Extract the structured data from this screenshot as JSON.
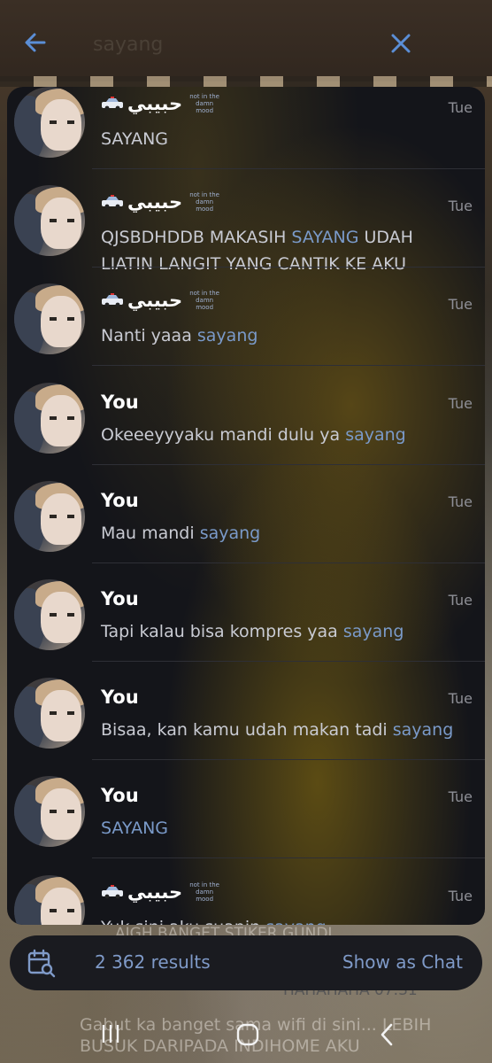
{
  "header": {
    "title": "sayang",
    "back_icon": "arrow-left-icon",
    "close_icon": "close-icon"
  },
  "results": [
    {
      "sender": "حبيبي",
      "sender_type": "contact",
      "status": "not in the damn mood",
      "time": "Tue",
      "parts": [
        {
          "t": "SAYANG",
          "h": false
        }
      ]
    },
    {
      "sender": "حبيبي",
      "sender_type": "contact",
      "status": "not in the damn mood",
      "time": "Tue",
      "parts": [
        {
          "t": "QJSBDHDDB MAKASIH ",
          "h": false
        },
        {
          "t": "SAYANG",
          "h": true
        },
        {
          "t": " UDAH LIATIN LANGIT YANG CANTIK KE AKU",
          "h": false
        }
      ]
    },
    {
      "sender": "حبيبي",
      "sender_type": "contact",
      "status": "not in the damn mood",
      "time": "Tue",
      "parts": [
        {
          "t": "Nanti yaaa ",
          "h": false
        },
        {
          "t": "sayang",
          "h": true
        }
      ]
    },
    {
      "sender": "You",
      "sender_type": "self",
      "status": "",
      "time": "Tue",
      "parts": [
        {
          "t": "Okeeeyyyaku mandi dulu ya ",
          "h": false
        },
        {
          "t": "sayang",
          "h": true
        }
      ]
    },
    {
      "sender": "You",
      "sender_type": "self",
      "status": "",
      "time": "Tue",
      "parts": [
        {
          "t": "Mau mandi ",
          "h": false
        },
        {
          "t": "sayang",
          "h": true
        }
      ]
    },
    {
      "sender": "You",
      "sender_type": "self",
      "status": "",
      "time": "Tue",
      "parts": [
        {
          "t": "Tapi kalau bisa kompres yaa ",
          "h": false
        },
        {
          "t": "sayang",
          "h": true
        }
      ]
    },
    {
      "sender": "You",
      "sender_type": "self",
      "status": "",
      "time": "Tue",
      "parts": [
        {
          "t": "Bisaa, kan kamu udah makan tadi ",
          "h": false
        },
        {
          "t": "sayang",
          "h": true
        }
      ]
    },
    {
      "sender": "You",
      "sender_type": "self",
      "status": "",
      "time": "Tue",
      "parts": [
        {
          "t": "SAYANG",
          "h": true
        }
      ]
    },
    {
      "sender": "حبيبي",
      "sender_type": "contact",
      "status": "not in the damn mood",
      "time": "Tue",
      "parts": [
        {
          "t": "Yuk sini aku suapin ",
          "h": false
        },
        {
          "t": "sayang",
          "h": true
        }
      ]
    }
  ],
  "searchbar": {
    "calendar_icon": "calendar-search-icon",
    "count": "2 362 results",
    "show_as_chat": "Show as Chat"
  },
  "background_chat": {
    "line_top": "AJGH BANGET STIKER GUNDI",
    "line_mid": "HAHAHAHA  07.31",
    "line_bottom_1": "Gabut ka banget sama wifi di sini... LEBIH",
    "line_bottom_2": "BUSUK DARIPADA INDIHOME AKU"
  },
  "colors": {
    "accent": "#5b8ed6",
    "highlight": "#7a9ac9",
    "panel": "#14151a"
  }
}
